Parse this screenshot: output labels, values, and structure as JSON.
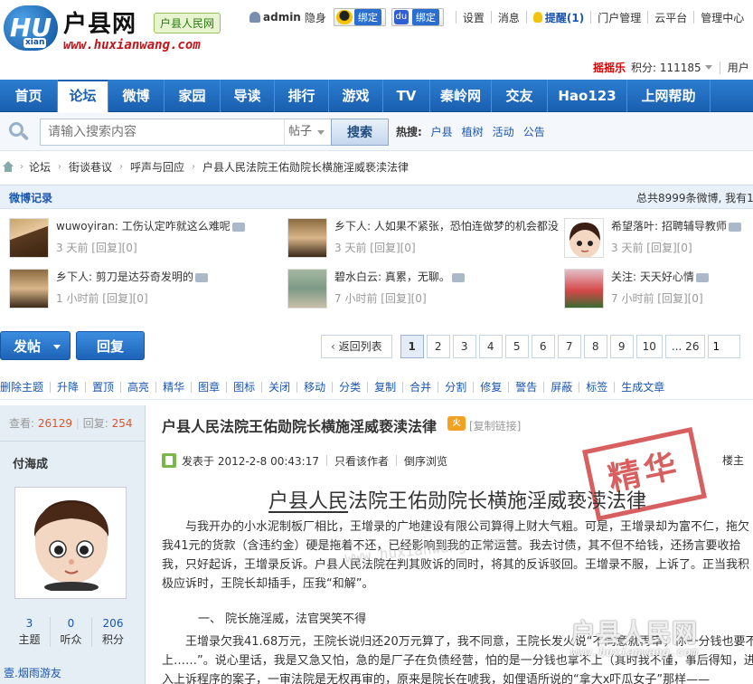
{
  "site": {
    "logo_letters": "HU",
    "logo_small": "xian",
    "name": "户县网",
    "tag": "户县人民网",
    "url": "www.huxianwang.com"
  },
  "userbar": {
    "username": "admin",
    "invisible": "隐身",
    "qq_bind": "绑定",
    "baidu_icon": "du",
    "baidu_bind": "绑定",
    "settings": "设置",
    "messages": "消息",
    "remind": "提醒(1)",
    "portal_admin": "门户管理",
    "cloud": "云平台",
    "admin_center": "管理中心"
  },
  "scorebar": {
    "shake": "摇摇乐",
    "credits": "积分: 111185",
    "user_group": "用户"
  },
  "nav": [
    "首页",
    "论坛",
    "微博",
    "家园",
    "导读",
    "排行",
    "游戏",
    "TV",
    "秦岭网",
    "交友",
    "Hao123",
    "上网帮助"
  ],
  "nav_active_index": 1,
  "search": {
    "placeholder": "请输入搜索内容",
    "type": "帖子",
    "button": "搜索",
    "hot_label": "热搜:",
    "hot_keywords": [
      "户县",
      "植树",
      "活动",
      "公告"
    ]
  },
  "breadcrumb": [
    "论坛",
    "街谈巷议",
    "呼声与回应",
    "户县人民法院王佑勋院长横施淫威亵渎法律"
  ],
  "weibo": {
    "title": "微博记录",
    "total": "总共8999条微博, 我有1",
    "items": [
      {
        "text": "wuwoyiran: 工伤认定咋就这么难呢",
        "meta": "3 天前 [回复][0]"
      },
      {
        "text": "乡下人: 人如果不紧张，恐怕连做梦的机会都没",
        "meta": "3 天前 [回复][0]"
      },
      {
        "text": "希望落叶: 招聘辅导教师",
        "meta": "3 天前 [回复][0]"
      },
      {
        "text": "乡下人: 剪刀是达芬奇发明的",
        "meta": "1 小时前 [回复][0]"
      },
      {
        "text": "碧水白云: 真累，无聊。",
        "meta": "7 小时前 [回复][0]"
      },
      {
        "text": "关注: 天天好心情",
        "meta": "7 小时前 [回复][0]"
      }
    ]
  },
  "actions": {
    "post": "发帖",
    "reply": "回复",
    "back_to_list": "返回列表",
    "pages": [
      "1",
      "2",
      "3",
      "4",
      "5",
      "6",
      "7",
      "8",
      "9",
      "10",
      "... 26"
    ],
    "current_page": "1",
    "page_input": "1"
  },
  "mod_tools": [
    "删除主题",
    "升降",
    "置顶",
    "高亮",
    "精华",
    "图章",
    "图标",
    "关闭",
    "移动",
    "分类",
    "复制",
    "合并",
    "分割",
    "修复",
    "警告",
    "屏蔽",
    "标签",
    "生成文章"
  ],
  "post": {
    "views_label": "查看:",
    "views": "26129",
    "replies_label": "回复:",
    "replies": "254",
    "author": "付海成",
    "author_stats": [
      {
        "n": "3",
        "label": "主题"
      },
      {
        "n": "0",
        "label": "听众"
      },
      {
        "n": "206",
        "label": "积分"
      }
    ],
    "author_group": "壹.烟雨游友",
    "title": "户县人民法院王佑勋院长横施淫威亵渎法律",
    "hot_badge": "火",
    "copy_link": "[复制链接]",
    "posted_at": "发表于 2012-2-8 00:43:17",
    "only_author": "只看该作者",
    "reverse": "倒序浏览",
    "floor": "楼主",
    "stamp": "精华",
    "article_title_pre": "户县人民",
    "article_title_post": "法院王佑勋院长横施淫威亵渎法律",
    "para1": "与我开办的小水泥制板厂相比，王增录的广地建设有限公司算得上财大气粗。可是，王增录却为富不仁，拖欠我41元的货款（含违约金）硬是拖着不还，已经影响到我的正常运营。我去讨债，其不但不给钱，还扬言要收拾我，只好起诉，王增录反诉。户县人民法院在判其败诉的同时，将其的反诉驳回。王增录不服，上诉了。正当我积极应诉时，王院长却插手，压我“和解”。",
    "section1": "一、 院长施淫威，法官哭笑不得",
    "para2": "王增录欠我41.68万元，王院长说归还20万元算了，我不同意，王院长发火说“不同意就再审，你一分钱也要不上……”。说心里话，我是又急又怕，急的是厂子在负债经营，怕的是一分钱也拿不上（其时我不懂，事后得知，进入上诉程序的案子，一审法院是无权再审的，原来是院长在唬我，如俚语所说的“拿大x吓瓜女子”那样——"
  },
  "watermark": {
    "url": "www.huxianwang.com",
    "big": "户县人民网",
    "url2": "www.huxianwang.com"
  }
}
